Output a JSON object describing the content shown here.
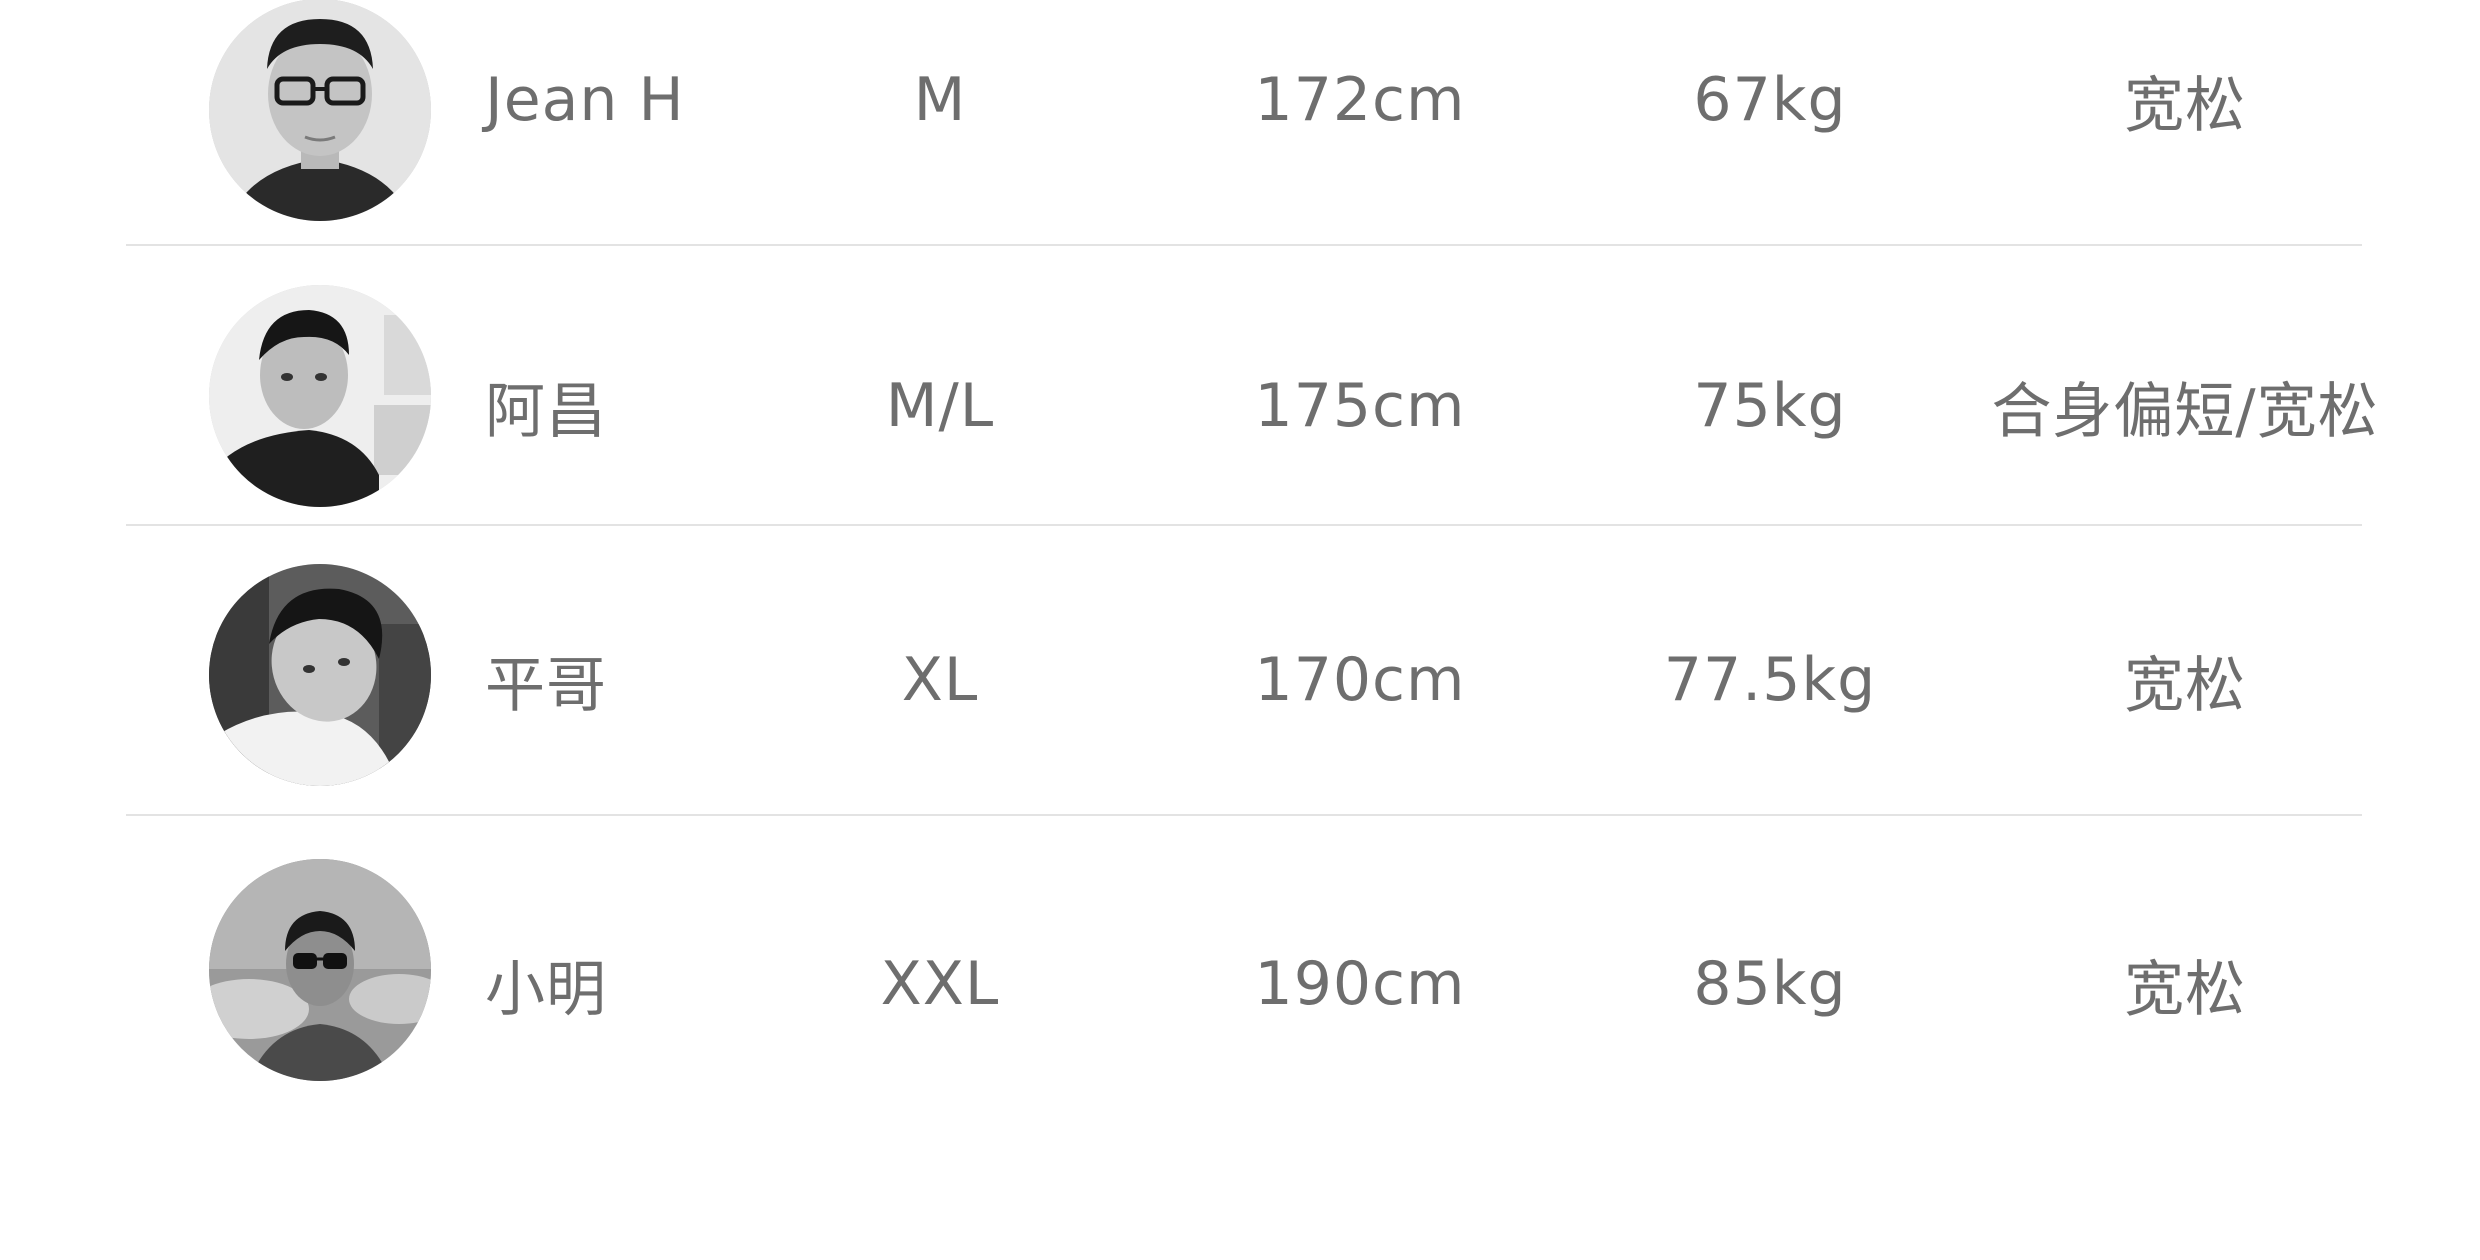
{
  "rows": [
    {
      "name": "Jean H",
      "size": "M",
      "height": "172cm",
      "weight": "67kg",
      "fit": "宽松",
      "avatar": "avatar-man-glasses"
    },
    {
      "name": "阿昌",
      "size": "M/L",
      "height": "175cm",
      "weight": "75kg",
      "fit": "合身偏短/宽松",
      "avatar": "avatar-man-dark-jacket"
    },
    {
      "name": "平哥",
      "size": "XL",
      "height": "170cm",
      "weight": "77.5kg",
      "fit": "宽松",
      "avatar": "avatar-man-white-shirt"
    },
    {
      "name": "小明",
      "size": "XXL",
      "height": "190cm",
      "weight": "85kg",
      "fit": "宽松",
      "avatar": "avatar-man-sunglasses-outdoor"
    }
  ],
  "colors": {
    "text": "#6e6e6e",
    "divider": "#e3e3e3",
    "background": "#ffffff"
  }
}
